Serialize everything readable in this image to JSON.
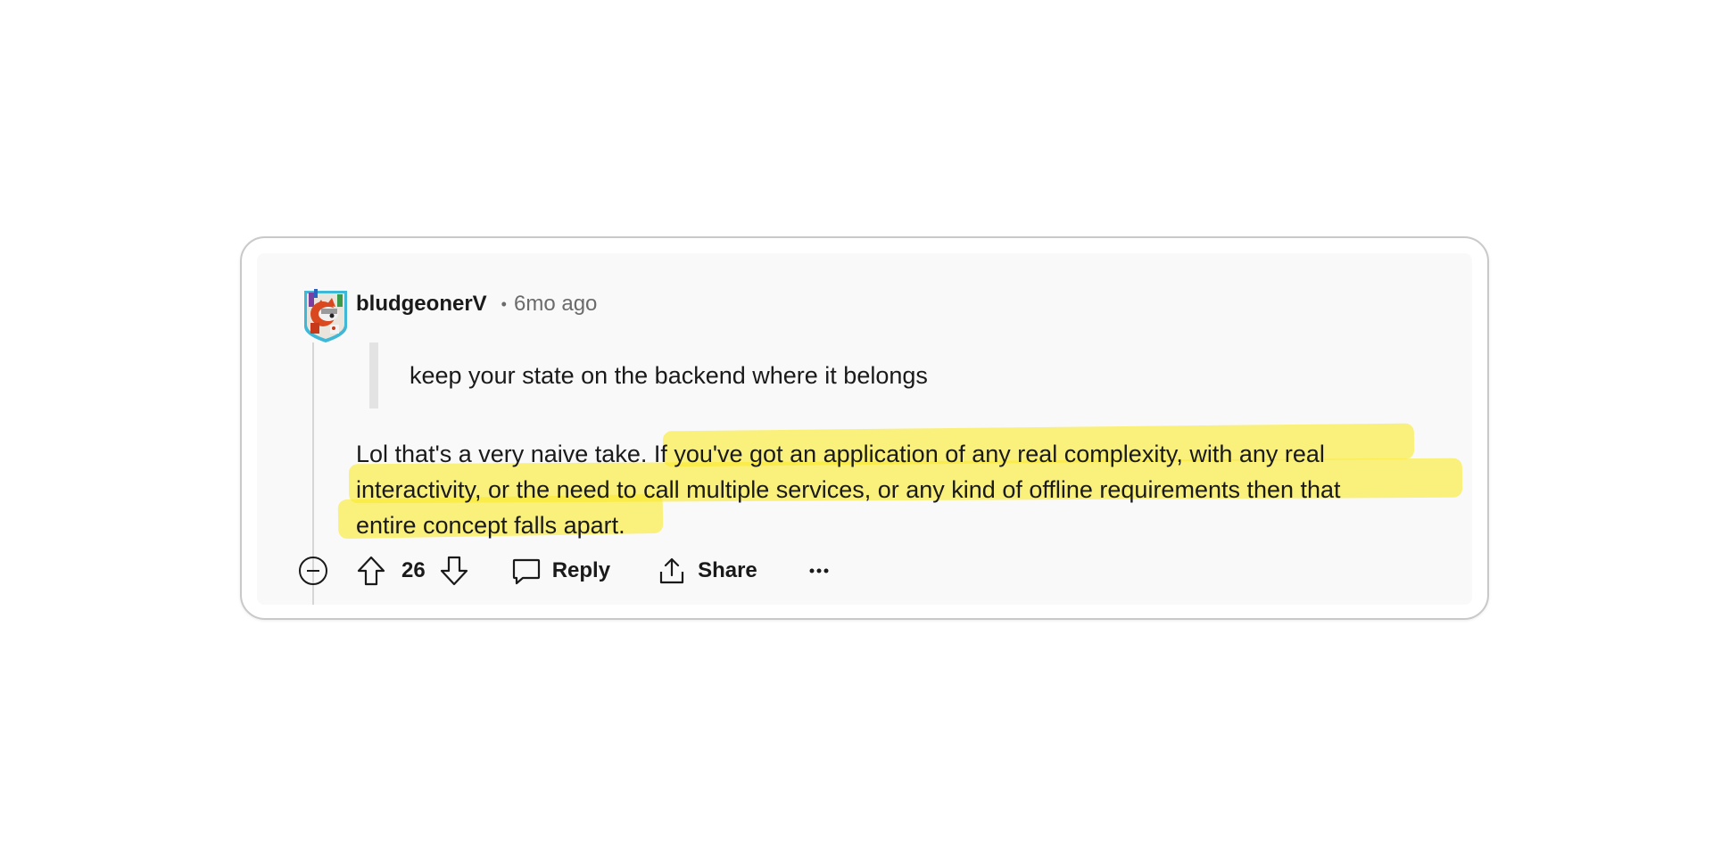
{
  "comment": {
    "username": "bludgeonerV",
    "separator": "•",
    "timestamp": "6mo ago",
    "quote": "keep your state on the backend where it belongs",
    "body_lines": [
      "Lol that's a very naive take. If you've got an application of any real complexity, with any real",
      "interactivity, or the need to call multiple services, or any kind of offline requirements then that",
      "entire concept falls apart."
    ]
  },
  "actions": {
    "score": "26",
    "reply_label": "Reply",
    "share_label": "Share",
    "more_label": "···"
  },
  "icons": {
    "collapse": "minus-circle-icon",
    "upvote": "arrow-up-icon",
    "downvote": "arrow-down-icon",
    "reply": "speech-bubble-icon",
    "share": "share-upload-icon",
    "more": "ellipsis-icon"
  },
  "colors": {
    "highlight": "#faea28",
    "panel_bg": "#f9f9f9",
    "text": "#1a1a1b",
    "muted": "#6b6b6b"
  }
}
